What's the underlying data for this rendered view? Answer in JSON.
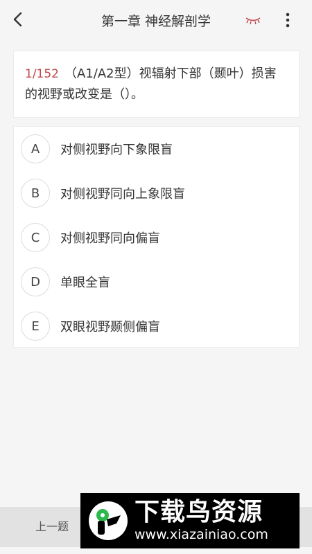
{
  "header": {
    "title": "第一章 神经解剖学",
    "back_icon": "chevron-left-icon",
    "eye_icon": "closed-eye-icon",
    "more_icon": "more-vertical-icon",
    "eye_color": "#c0464a"
  },
  "question": {
    "number": "1/152",
    "text": "（A1/A2型）视辐射下部（颞叶）损害的视野或改变是（）。"
  },
  "options": [
    {
      "letter": "A",
      "text": "对侧视野向下象限盲"
    },
    {
      "letter": "B",
      "text": "对侧视野同向上象限盲"
    },
    {
      "letter": "C",
      "text": "对侧视野同向偏盲"
    },
    {
      "letter": "D",
      "text": "单眼全盲"
    },
    {
      "letter": "E",
      "text": "双眼视野颞侧偏盲"
    }
  ],
  "footer": {
    "prev_label": "上一题"
  },
  "watermark": {
    "title": "下载鸟资源",
    "url": "www.xiazainiao.com",
    "accent": "#2db84d"
  }
}
